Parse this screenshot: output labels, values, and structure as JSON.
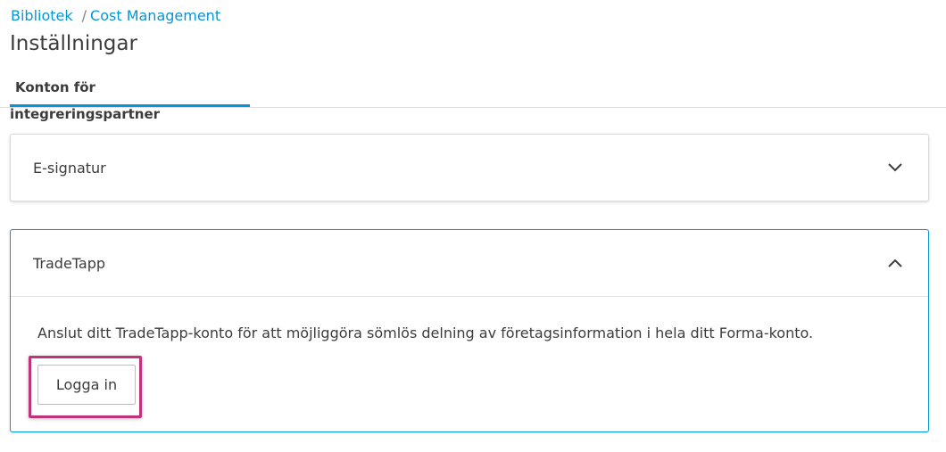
{
  "breadcrumb": {
    "items": [
      {
        "label": "Bibliotek"
      },
      {
        "label": "Cost Management"
      }
    ],
    "separator": "/"
  },
  "page": {
    "title": "Inställningar"
  },
  "tabs": [
    {
      "label": "Konton för integreringspartner",
      "active": true
    }
  ],
  "panels": [
    {
      "title": "E-signatur",
      "expanded": false,
      "chevron_icon": "chevron-down-icon"
    },
    {
      "title": "TradeTapp",
      "expanded": true,
      "chevron_icon": "chevron-up-icon",
      "description": "Anslut ditt TradeTapp-konto för att möjliggöra sömlös delning av företagsinformation i hela ditt Forma-konto.",
      "button_label": "Logga in"
    }
  ],
  "colors": {
    "accent": "#0696d7",
    "highlight": "#c0327a",
    "text": "#3c3c3c"
  }
}
